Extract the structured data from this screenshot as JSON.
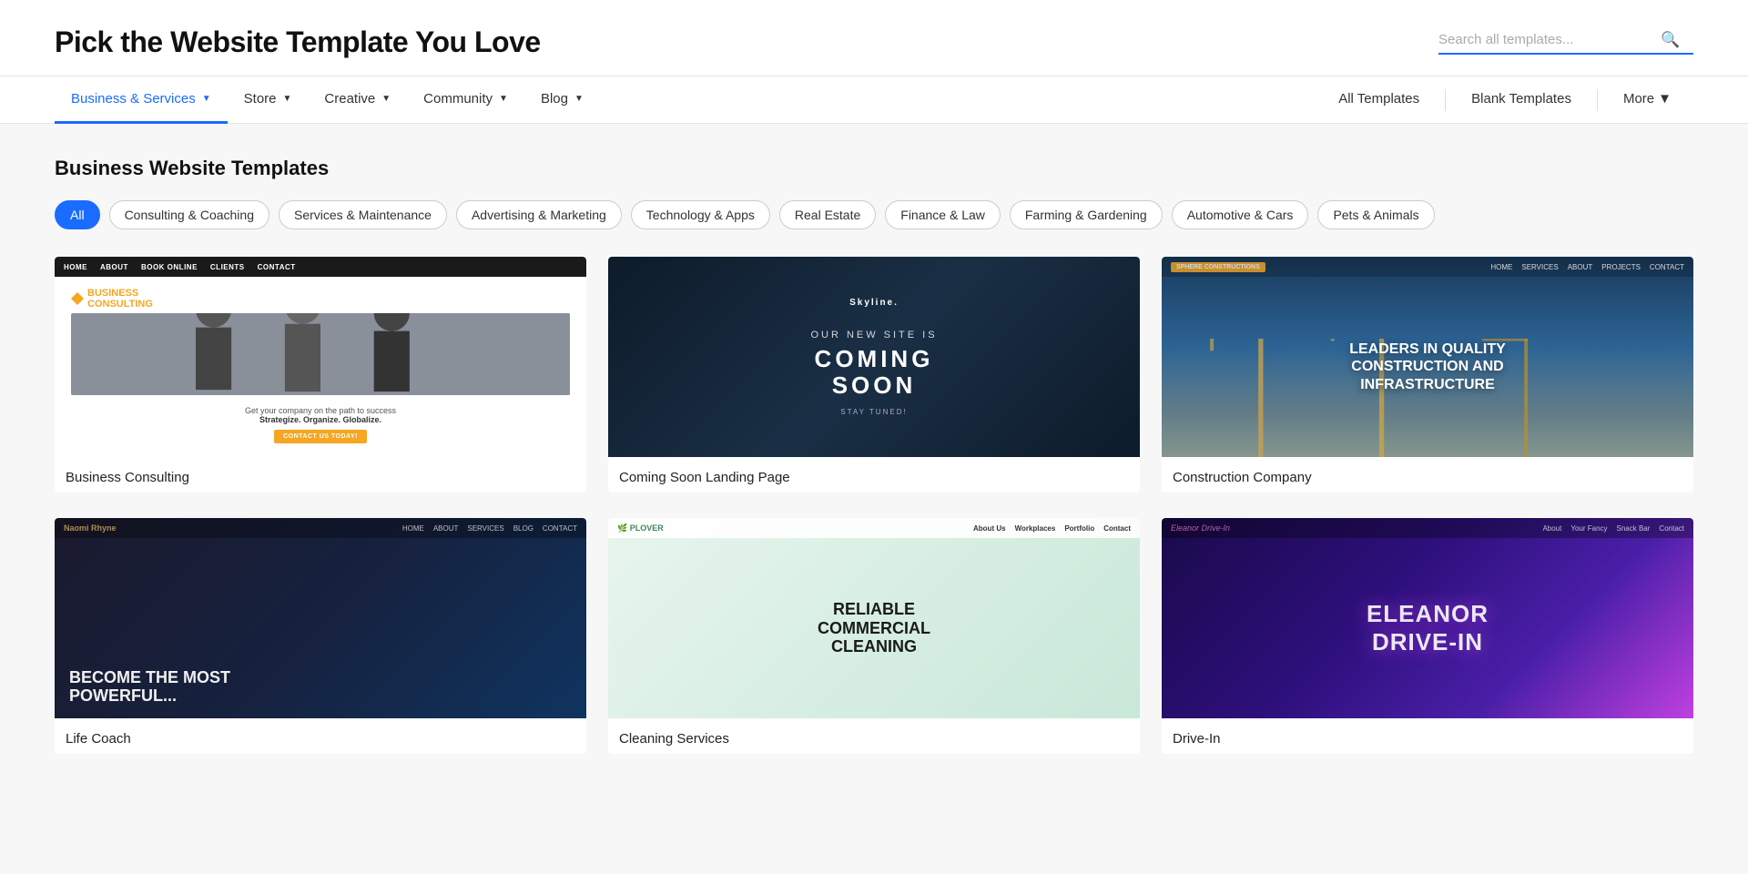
{
  "header": {
    "title": "Pick the Website Template You Love",
    "search_placeholder": "Search all templates..."
  },
  "nav": {
    "left_items": [
      {
        "id": "business",
        "label": "Business & Services",
        "active": true,
        "chevron": true
      },
      {
        "id": "store",
        "label": "Store",
        "active": false,
        "chevron": true
      },
      {
        "id": "creative",
        "label": "Creative",
        "active": false,
        "chevron": true
      },
      {
        "id": "community",
        "label": "Community",
        "active": false,
        "chevron": true
      },
      {
        "id": "blog",
        "label": "Blog",
        "active": false,
        "chevron": true
      }
    ],
    "right_items": [
      {
        "id": "all-templates",
        "label": "All Templates"
      },
      {
        "id": "blank-templates",
        "label": "Blank Templates"
      },
      {
        "id": "more",
        "label": "More",
        "chevron": true
      }
    ]
  },
  "main": {
    "section_title": "Business Website Templates",
    "filters": [
      {
        "id": "all",
        "label": "All",
        "active": true
      },
      {
        "id": "consulting",
        "label": "Consulting & Coaching",
        "active": false
      },
      {
        "id": "services",
        "label": "Services & Maintenance",
        "active": false
      },
      {
        "id": "advertising",
        "label": "Advertising & Marketing",
        "active": false
      },
      {
        "id": "technology",
        "label": "Technology & Apps",
        "active": false
      },
      {
        "id": "real-estate",
        "label": "Real Estate",
        "active": false
      },
      {
        "id": "finance",
        "label": "Finance & Law",
        "active": false
      },
      {
        "id": "farming",
        "label": "Farming & Gardening",
        "active": false
      },
      {
        "id": "automotive",
        "label": "Automotive & Cars",
        "active": false
      },
      {
        "id": "pets",
        "label": "Pets & Animals",
        "active": false
      }
    ],
    "templates": [
      {
        "id": "business-consulting",
        "label": "Business Consulting",
        "type": "consulting"
      },
      {
        "id": "coming-soon",
        "label": "Coming Soon Landing Page",
        "type": "coming-soon"
      },
      {
        "id": "construction",
        "label": "Construction Company",
        "type": "construction"
      },
      {
        "id": "coach",
        "label": "Life Coach",
        "type": "dark-portrait"
      },
      {
        "id": "cleaning",
        "label": "Cleaning Services",
        "type": "cleaning"
      },
      {
        "id": "drive-in",
        "label": "Drive-In",
        "type": "neon"
      }
    ]
  }
}
